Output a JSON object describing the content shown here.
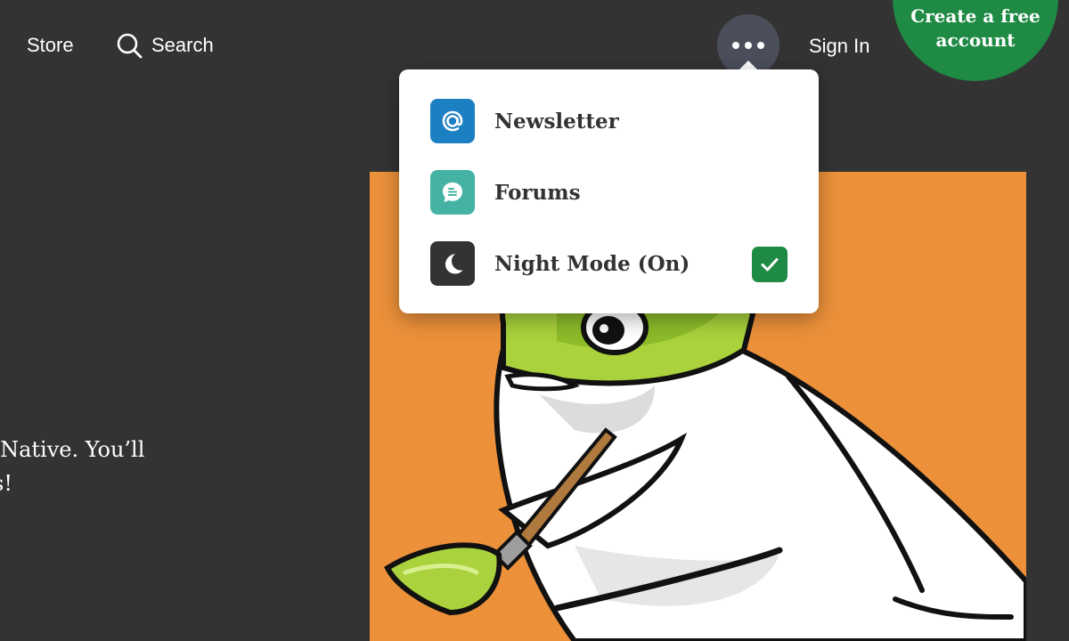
{
  "nav": {
    "store": "Store",
    "search": "Search",
    "sign_in": "Sign In",
    "more_icon": "ellipsis-icon",
    "create_account": {
      "line1": "Create a free",
      "line2": "account"
    }
  },
  "hero": {
    "line1": "/Native. You’ll",
    "line2": "s!"
  },
  "menu": {
    "items": [
      {
        "label": "Newsletter",
        "icon": "at-sign-icon"
      },
      {
        "label": "Forums",
        "icon": "chat-bubble-icon"
      },
      {
        "label": "Night Mode (On)",
        "icon": "moon-icon",
        "checked": true
      }
    ]
  },
  "colors": {
    "background": "#333333",
    "cta": "#1e8a44",
    "hero": "#ec913a",
    "newsletter": "#1c7fc1",
    "forums": "#45b3a3"
  }
}
